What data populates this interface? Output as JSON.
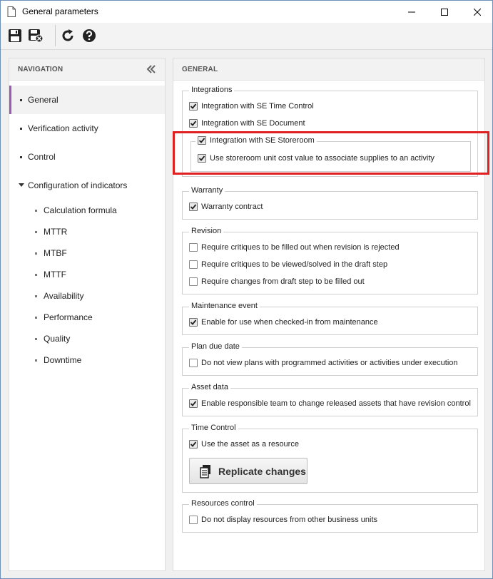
{
  "window": {
    "title": "General parameters"
  },
  "toolbar": {
    "buttons": [
      {
        "name": "save-icon"
      },
      {
        "name": "save-and-close-icon"
      },
      {
        "name": "refresh-icon"
      },
      {
        "name": "help-icon"
      }
    ]
  },
  "navigation": {
    "header": "NAVIGATION",
    "items": [
      {
        "label": "General",
        "active": true
      },
      {
        "label": "Verification activity"
      },
      {
        "label": "Control"
      },
      {
        "label": "Configuration of indicators",
        "expanded": true
      }
    ],
    "subitems": [
      "Calculation formula",
      "MTTR",
      "MTBF",
      "MTTF",
      "Availability",
      "Performance",
      "Quality",
      "Downtime"
    ]
  },
  "main": {
    "header": "GENERAL",
    "integrations": {
      "title": "Integrations",
      "time_control": "Integration with SE Time Control",
      "document": "Integration with SE Document",
      "storeroom": "Integration with SE Storeroom",
      "unit_cost": "Use storeroom unit cost value to associate supplies to an activity"
    },
    "warranty": {
      "title": "Warranty",
      "contract": "Warranty contract"
    },
    "revision": {
      "title": "Revision",
      "critiques_filled": "Require critiques to be filled out when revision is rejected",
      "critiques_viewed": "Require critiques to be viewed/solved in the draft step",
      "changes_filled": "Require changes from draft step to be filled out"
    },
    "maintenance_event": {
      "title": "Maintenance event",
      "enable": "Enable for use when checked-in from maintenance"
    },
    "plan_due_date": {
      "title": "Plan due date",
      "no_view": "Do not view plans with programmed activities or activities under execution"
    },
    "asset_data": {
      "title": "Asset data",
      "enable_team": "Enable responsible team to change released assets that have revision control"
    },
    "time_control": {
      "title": "Time Control",
      "use_asset": "Use the asset as a resource",
      "replicate": "Replicate changes"
    },
    "resources_control": {
      "title": "Resources control",
      "no_display": "Do not display resources from other business units"
    }
  },
  "colors": {
    "accent": "#9b59b6",
    "highlight": "#e02020"
  }
}
